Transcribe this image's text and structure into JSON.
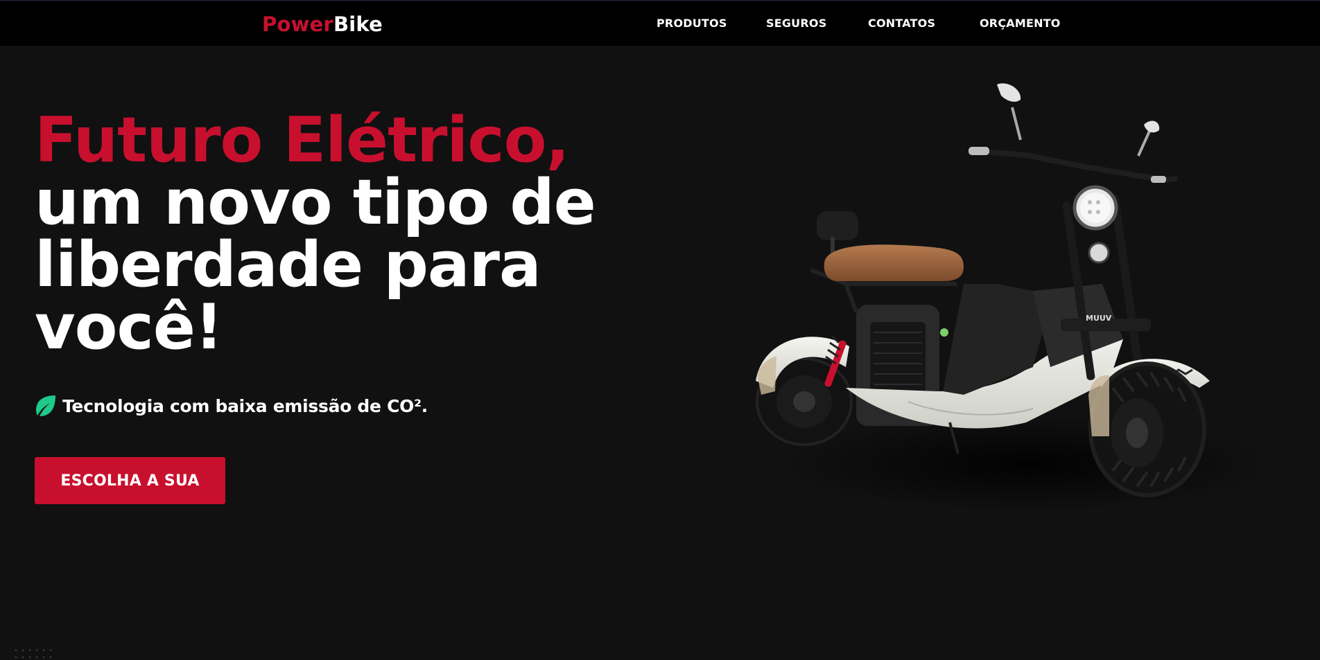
{
  "header": {
    "logo": {
      "part1": "Power",
      "part2": "Bike"
    },
    "nav": [
      {
        "label": "PRODUTOS"
      },
      {
        "label": "SEGUROS"
      },
      {
        "label": "CONTATOS"
      },
      {
        "label": "ORÇAMENTO"
      }
    ]
  },
  "hero": {
    "title_accent": "Futuro Elétrico,",
    "title_lines": [
      "um novo tipo de",
      "liberdade para",
      "você!"
    ],
    "eco_icon": "leaf-icon",
    "eco_text": "Tecnologia com baixa emissão de CO².",
    "cta_label": "ESCOLHA A SUA",
    "product_image": "electric-scooter",
    "scooter_badge": "MUUV"
  },
  "colors": {
    "accent": "#c8102e",
    "background": "#111111",
    "header_bg": "#000000",
    "leaf": "#1fc98a"
  }
}
